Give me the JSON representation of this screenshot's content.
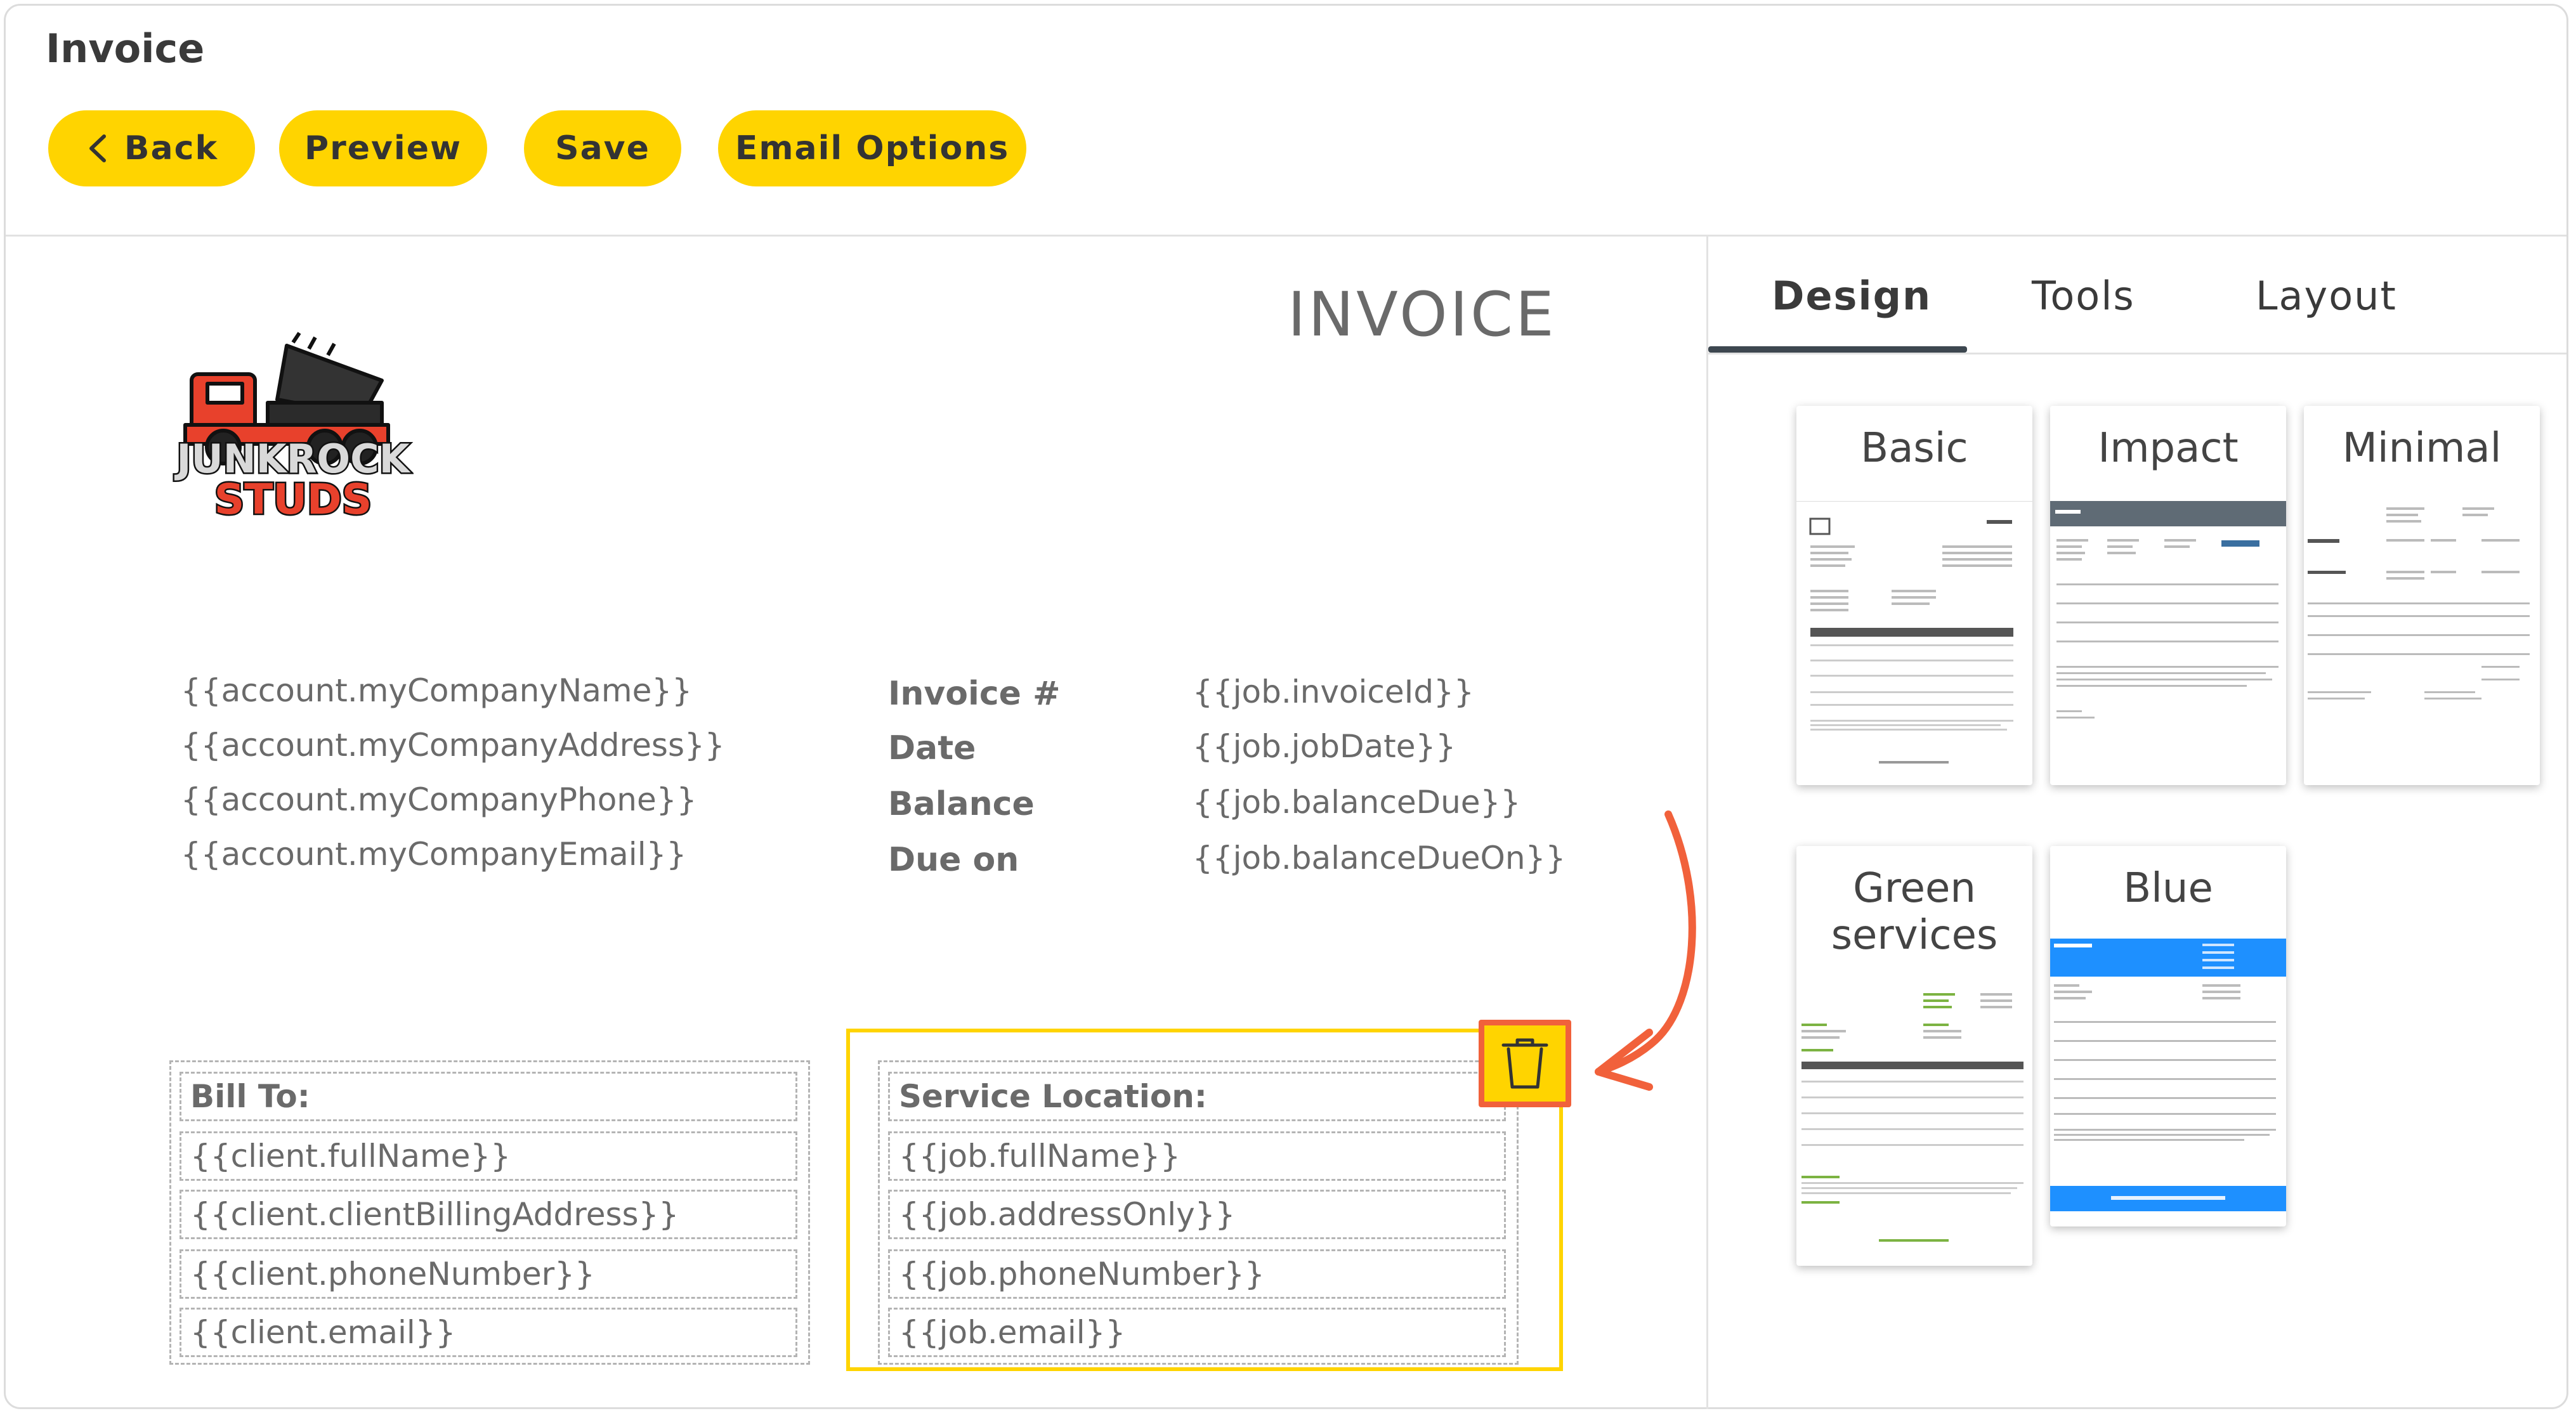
{
  "header": {
    "title": "Invoice",
    "buttons": {
      "back": "Back",
      "preview": "Preview",
      "save": "Save",
      "email_options": "Email Options"
    }
  },
  "logo": {
    "line1": "JUNKROCK",
    "line2": "STUDS"
  },
  "invoice": {
    "heading": "INVOICE",
    "company_fields": [
      "{{account.myCompanyName}}",
      "{{account.myCompanyAddress}}",
      "{{account.myCompanyPhone}}",
      "{{account.myCompanyEmail}}"
    ],
    "meta": [
      {
        "label": "Invoice #",
        "value": "{{job.invoiceId}}"
      },
      {
        "label": "Date",
        "value": "{{job.jobDate}}"
      },
      {
        "label": "Balance",
        "value": "{{job.balanceDue}}"
      },
      {
        "label": "Due on",
        "value": "{{job.balanceDueOn}}"
      }
    ],
    "bill_to": {
      "title": "Bill To:",
      "fields": [
        "{{client.fullName}}",
        "{{client.clientBillingAddress}}",
        "{{client.phoneNumber}}",
        "{{client.email}}"
      ]
    },
    "service_location": {
      "title": "Service Location:",
      "fields": [
        "{{job.fullName}}",
        "{{job.addressOnly}}",
        "{{job.phoneNumber}}",
        "{{job.email}}"
      ]
    }
  },
  "panel": {
    "tabs": [
      "Design",
      "Tools",
      "Layout"
    ],
    "active_tab": "Design",
    "templates": [
      "Basic",
      "Impact",
      "Minimal",
      "Green services",
      "Blue"
    ],
    "template_title_lines": {
      "green": [
        "Green",
        "services"
      ]
    }
  },
  "icons": {
    "back": "chevron-left-icon",
    "delete": "trash-icon",
    "annotation": "curved-arrow-icon"
  },
  "colors": {
    "accent": "#ffd400",
    "annotation": "#f1613b",
    "tab_underline": "#3d4750",
    "impact_header": "#5f6b75",
    "blue_header": "#1e90ff",
    "green_text": "#7cb342"
  }
}
